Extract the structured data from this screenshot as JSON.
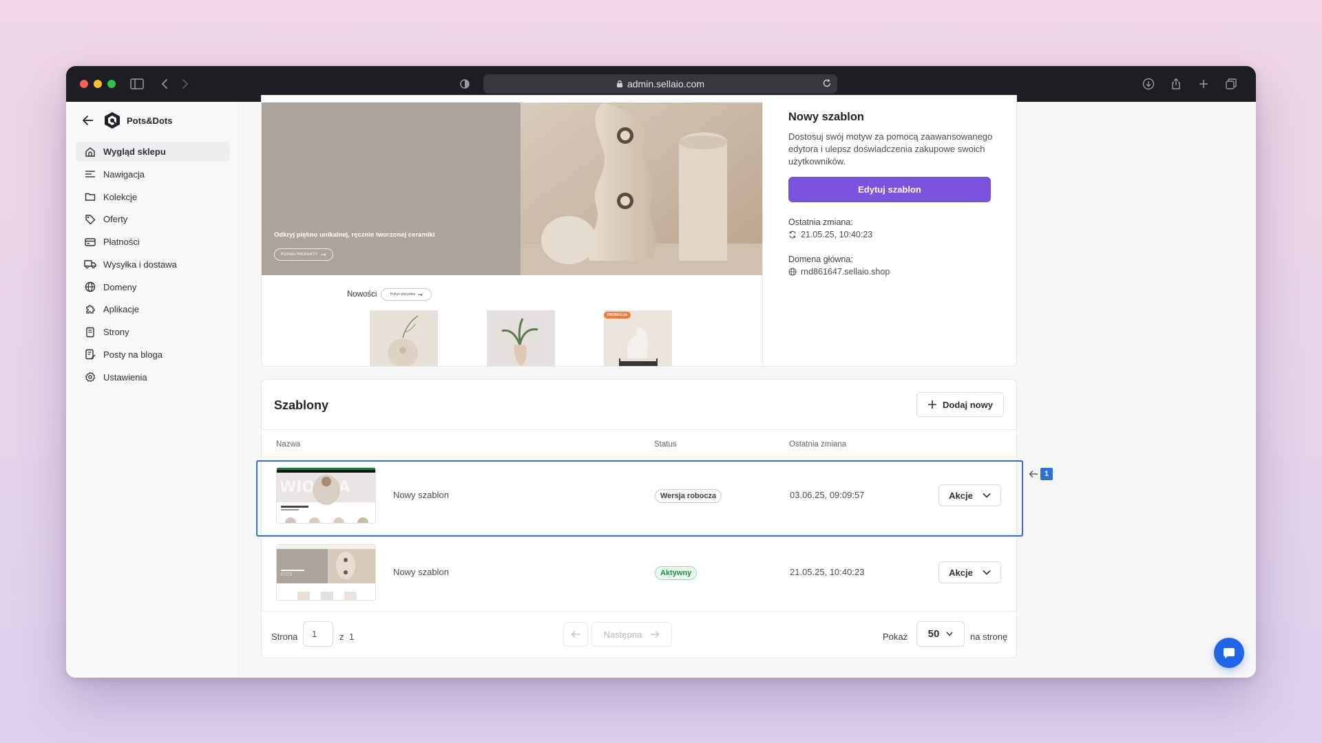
{
  "browser": {
    "url": "admin.sellaio.com"
  },
  "sidebar": {
    "store_name": "Pots&Dots",
    "items": [
      {
        "label": "Wygląd sklepu",
        "icon": "storefront-icon"
      },
      {
        "label": "Nawigacja",
        "icon": "menu-lines-icon"
      },
      {
        "label": "Kolekcje",
        "icon": "folder-icon"
      },
      {
        "label": "Oferty",
        "icon": "tag-icon"
      },
      {
        "label": "Płatności",
        "icon": "credit-card-icon"
      },
      {
        "label": "Wysyłka i dostawa",
        "icon": "truck-icon"
      },
      {
        "label": "Domeny",
        "icon": "globe-icon"
      },
      {
        "label": "Aplikacje",
        "icon": "puzzle-icon"
      },
      {
        "label": "Strony",
        "icon": "page-icon"
      },
      {
        "label": "Posty na bloga",
        "icon": "blog-post-icon"
      },
      {
        "label": "Ustawienia",
        "icon": "gear-icon"
      }
    ]
  },
  "preview": {
    "hero_text": "Odkryj piękno unikalnej, ręcznie tworzonej ceramiki",
    "hero_button": "POZNAJ PRODUKTY",
    "news_label": "Nowości",
    "news_button": "Pokaż wszystkie",
    "promo_badge": "PROMOCJA"
  },
  "current_theme": {
    "title": "Nowy szablon",
    "description": "Dostosuj swój motyw za pomocą zaawansowanego edytora i ulepsz doświadczenia zakupowe swoich użytkowników.",
    "edit_button": "Edytuj szablon",
    "last_change_label": "Ostatnia zmiana:",
    "last_change_value": "21.05.25, 10:40:23",
    "domain_label": "Domena główna:",
    "domain_value": "rnd861647.sellaio.shop"
  },
  "templates": {
    "title": "Szablony",
    "add_button": "Dodaj nowy",
    "columns": {
      "name": "Nazwa",
      "status": "Status",
      "last_change": "Ostatnia zmiana"
    },
    "rows": [
      {
        "name": "Nowy szablon",
        "status": "Wersja robocza",
        "last_change": "03.06.25, 09:09:57",
        "action": "Akcje"
      },
      {
        "name": "Nowy szablon",
        "status": "Aktywny",
        "last_change": "21.05.25, 10:40:23",
        "action": "Akcje"
      }
    ],
    "pagination": {
      "page_label": "Strona",
      "page_value": "1",
      "of_label": "z",
      "total_pages": "1",
      "next_label": "Następna",
      "show_label": "Pokaż",
      "per_page": "50",
      "per_page_suffix": "na stronę"
    }
  },
  "annotation": {
    "marker_number": "1"
  },
  "colors": {
    "accent": "#7b53dc",
    "highlight": "#2f6fdc",
    "active_status": "#1f8a4c"
  }
}
